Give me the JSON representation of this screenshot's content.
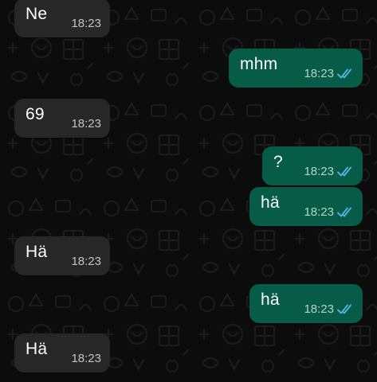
{
  "colors": {
    "incoming_bubble": "#272727",
    "outgoing_bubble": "#065c47",
    "read_ticks": "#53bdeb",
    "background": "#0c0c0c"
  },
  "messages": [
    {
      "direction": "incoming",
      "text": "Ne",
      "time": "18:23"
    },
    {
      "direction": "outgoing",
      "text": "mhm",
      "time": "18:23",
      "status_icon": "double-check-read-icon"
    },
    {
      "direction": "incoming",
      "text": "69",
      "time": "18:23"
    },
    {
      "direction": "outgoing",
      "text": "?",
      "time": "18:23",
      "status_icon": "double-check-read-icon"
    },
    {
      "direction": "outgoing",
      "text": "hä",
      "time": "18:23",
      "status_icon": "double-check-read-icon"
    },
    {
      "direction": "incoming",
      "text": "Hä",
      "time": "18:23"
    },
    {
      "direction": "outgoing",
      "text": "hä",
      "time": "18:23",
      "status_icon": "double-check-read-icon"
    },
    {
      "direction": "incoming",
      "text": "Hä",
      "time": "18:23"
    }
  ]
}
